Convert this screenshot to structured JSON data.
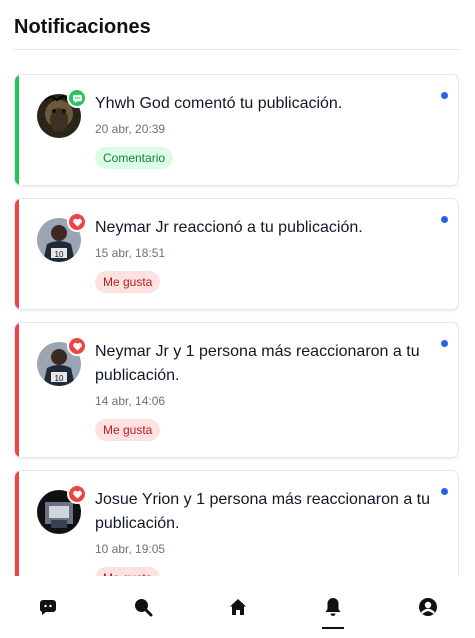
{
  "header": {
    "title": "Notificaciones"
  },
  "notifications": [
    {
      "actor": "Yhwh God",
      "text": "Yhwh God comentó tu publicación.",
      "time": "20 abr, 20:39",
      "tag": "Comentario",
      "type": "comment",
      "unread": true,
      "badge_icon": "chat-bubble-icon"
    },
    {
      "actor": "Neymar Jr",
      "text": "Neymar Jr reaccionó a tu publicación.",
      "time": "15 abr, 18:51",
      "tag": "Me gusta",
      "type": "like",
      "unread": true,
      "badge_icon": "heart-icon"
    },
    {
      "actor": "Neymar Jr",
      "text": "Neymar Jr y 1 persona más reaccionaron a tu publicación.",
      "time": "14 abr, 14:06",
      "tag": "Me gusta",
      "type": "like",
      "unread": true,
      "badge_icon": "heart-icon"
    },
    {
      "actor": "Josue Yrion",
      "text": "Josue Yrion y 1 persona más reaccionaron a tu publicación.",
      "time": "10 abr, 19:05",
      "tag": "Me gusta",
      "type": "like",
      "unread": true,
      "badge_icon": "heart-icon"
    }
  ],
  "bottom_nav": {
    "items": [
      {
        "icon": "chat-icon",
        "active": false
      },
      {
        "icon": "search-icon",
        "active": false
      },
      {
        "icon": "home-icon",
        "active": false
      },
      {
        "icon": "bell-icon",
        "active": true
      },
      {
        "icon": "profile-icon",
        "active": false
      }
    ]
  },
  "colors": {
    "comment_accent": "#22c55e",
    "like_accent": "#ef4444",
    "unread_dot": "#2563eb"
  }
}
